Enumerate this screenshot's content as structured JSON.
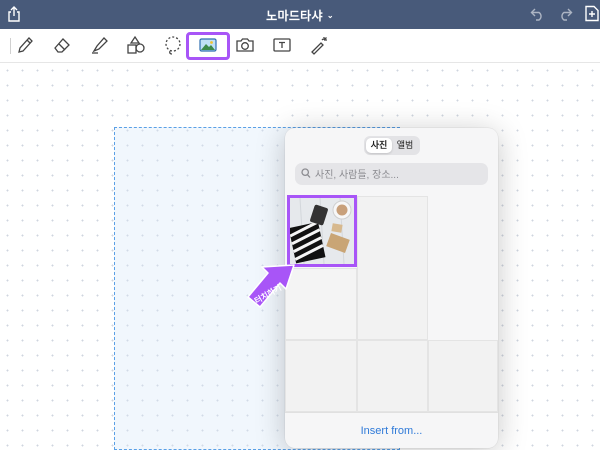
{
  "titlebar": {
    "title": "노마드타샤",
    "share_icon": "share-icon",
    "undo_icon": "undo-icon",
    "redo_icon": "redo-icon",
    "add_icon": "add-page-icon"
  },
  "toolbar": {
    "tools": [
      "pen-icon",
      "eraser-icon",
      "highlighter-icon",
      "shapes-icon",
      "lasso-icon",
      "image-icon",
      "camera-icon",
      "text-icon",
      "laser-pointer-icon"
    ],
    "active_tool": "image-icon",
    "highlight_color": "#a855f7"
  },
  "photo_picker": {
    "tabs": [
      "사진",
      "앨범"
    ],
    "selected_tab": "사진",
    "search_placeholder": "사진, 사람들, 장소...",
    "insert_from": "Insert from..."
  },
  "callout": {
    "label": "터치하기",
    "color": "#a855f7"
  }
}
